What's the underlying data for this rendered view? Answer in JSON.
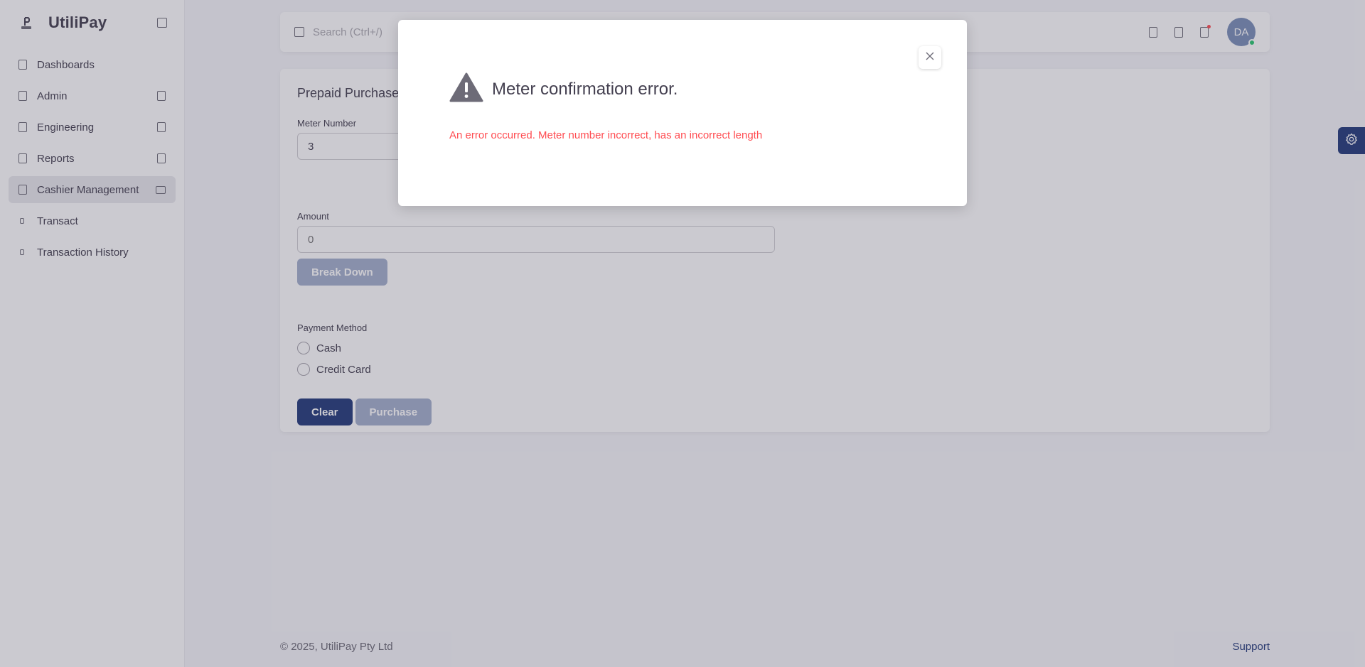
{
  "app": {
    "name": "UtiliPay"
  },
  "sidebar": {
    "items": [
      {
        "label": "Dashboards"
      },
      {
        "label": "Admin"
      },
      {
        "label": "Engineering"
      },
      {
        "label": "Reports"
      },
      {
        "label": "Cashier Management"
      },
      {
        "label": "Transact"
      },
      {
        "label": "Transaction History"
      }
    ]
  },
  "navbar": {
    "search_placeholder": "Search (Ctrl+/)",
    "avatar_initials": "DA"
  },
  "card": {
    "title": "Prepaid Purchase",
    "meter_label": "Meter Number",
    "meter_value": "3",
    "amount_label": "Amount",
    "amount_placeholder": "0",
    "breakdown_label": "Break Down",
    "payment_label": "Payment Method",
    "payment_options": [
      "Cash",
      "Credit Card"
    ],
    "clear_label": "Clear",
    "purchase_label": "Purchase"
  },
  "footer": {
    "copyright": "© 2025, UtiliPay Pty Ltd",
    "support": "Support"
  },
  "modal": {
    "title": "Meter confirmation error.",
    "message": "An error occurred. Meter number incorrect, has an incorrect length",
    "close_symbol": "×"
  },
  "colors": {
    "primary": "#233a7a",
    "error": "#ff4c51",
    "online": "#28c76f"
  }
}
